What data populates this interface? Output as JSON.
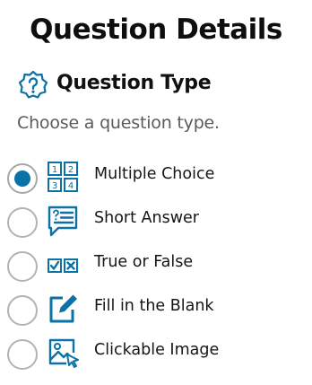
{
  "header": {
    "title": "Question Details"
  },
  "section": {
    "label": "Question Type",
    "icon": "question-badge-icon"
  },
  "subtitle": "Choose a question type.",
  "accent_color": "#0a72a6",
  "options": [
    {
      "label": "Multiple Choice",
      "icon": "numbered-grid-icon",
      "selected": true
    },
    {
      "label": "Short Answer",
      "icon": "text-bubble-icon",
      "selected": false
    },
    {
      "label": "True or False",
      "icon": "check-cross-icon",
      "selected": false
    },
    {
      "label": "Fill in the Blank",
      "icon": "pencil-edit-icon",
      "selected": false
    },
    {
      "label": "Clickable Image",
      "icon": "image-pointer-icon",
      "selected": false
    }
  ]
}
